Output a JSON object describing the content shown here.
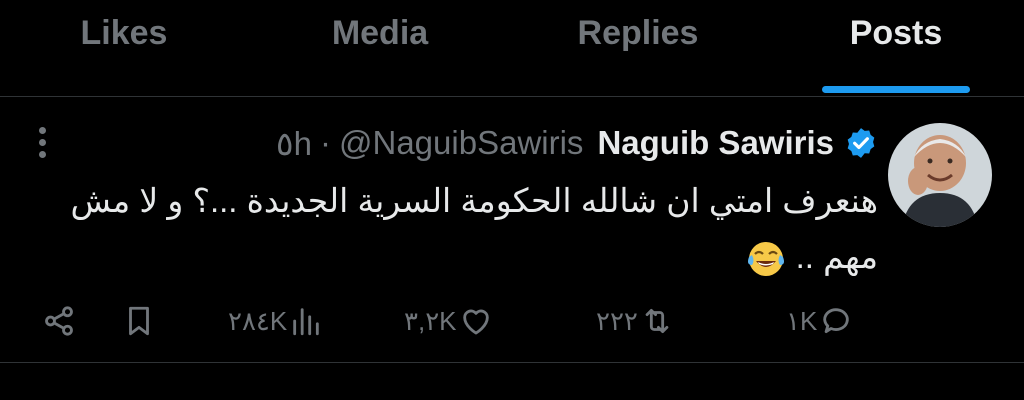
{
  "tabs": [
    {
      "label": "Likes"
    },
    {
      "label": "Media"
    },
    {
      "label": "Replies"
    },
    {
      "label": "Posts",
      "active": true
    }
  ],
  "tweet": {
    "time": "٥h",
    "separator": "·",
    "handle": "@NaguibSawiris",
    "name": "Naguib Sawiris",
    "verified": true,
    "text_line1": "هنعرف امتي ان شالله الحكومة السرية الجديدة ...؟ و لا مش",
    "text_line2": "مهم .. ",
    "emoji": "face-with-tears-of-joy",
    "actions": {
      "views": "٢٨٤K",
      "likes": "٣,٢K",
      "reposts": "٢٢٢",
      "replies": "١K"
    }
  },
  "colors": {
    "background": "#000000",
    "text": "#e7e9ea",
    "muted": "#71767b",
    "accent": "#1d9bf0",
    "divider": "#2f3336"
  }
}
